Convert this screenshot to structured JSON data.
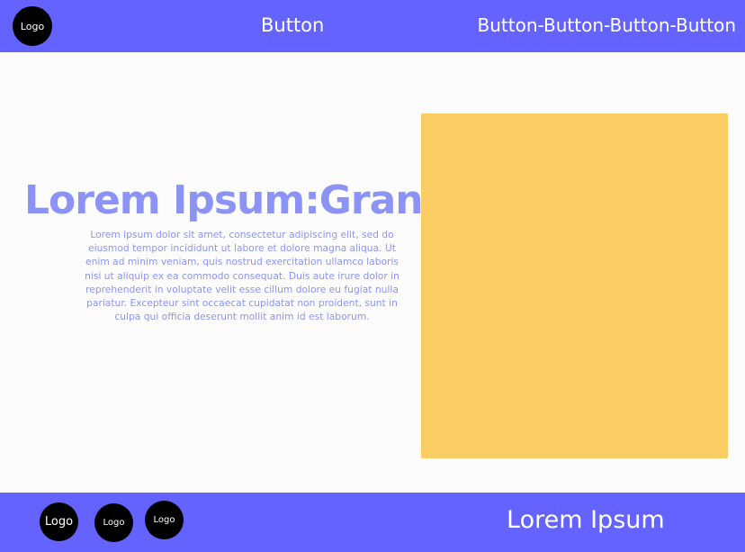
{
  "header": {
    "logo_label": "Logo",
    "nav_button_center": "Button",
    "nav_button_right": "Button-Button-Button-Button"
  },
  "main": {
    "title": "Lorem Ipsum:Grant",
    "body": "Lorem ipsum dolor sit amet, consectetur adipiscing elit, sed do eiusmod tempor incididunt ut labore et dolore magna aliqua. Ut enim ad minim veniam, quis nostrud exercitation ullamco laboris nisi ut aliquip ex ea commodo consequat. Duis aute irure dolor in reprehenderit in voluptate velit esse cillum dolore eu fugiat nulla pariatur. Excepteur sint occaecat cupidatat non proident, sunt in culpa qui officia deserunt mollit anim id est laborum."
  },
  "footer": {
    "logos": [
      "Logo",
      "Logo",
      "Logo"
    ],
    "text": "Lorem Ipsum"
  },
  "colors": {
    "bar": "#6463ff",
    "accent_text": "#8b94f6",
    "image_placeholder": "#fccc64",
    "background": "#fdfcfd"
  }
}
